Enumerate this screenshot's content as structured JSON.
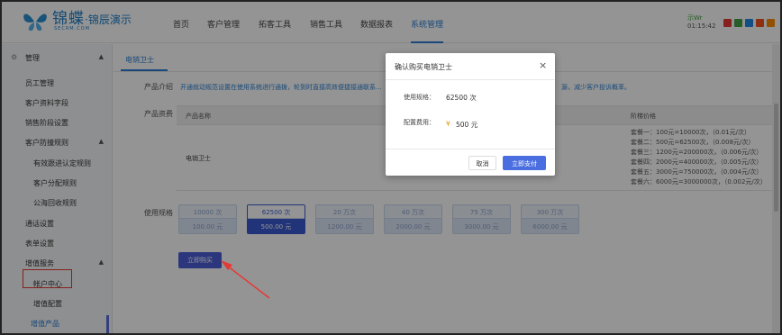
{
  "header": {
    "logo_cn": "锦蝶",
    "logo_sub": "·锦辰演示",
    "logo_en": "SECRM.COM",
    "nav": [
      "首页",
      "客户管理",
      "拓客工具",
      "销售工具",
      "数据报表",
      "系统管理"
    ],
    "active_nav": "系统管理",
    "date": "示Wr",
    "time": "01:15:42",
    "icon_colors": [
      "#e53935",
      "#43a047",
      "#1e88e5",
      "#f4511e",
      "#fb8c00"
    ]
  },
  "sidebar": {
    "items": [
      {
        "label": "管理",
        "chev": "▲"
      },
      {
        "label": "员工管理"
      },
      {
        "label": "客户资料字段"
      },
      {
        "label": "销售阶段设置"
      },
      {
        "label": "客户防撞规则",
        "chev": "▲"
      },
      {
        "label": "有效跟进认定规则"
      },
      {
        "label": "客户分配规则"
      },
      {
        "label": "公海回收规则"
      },
      {
        "label": "通话设置"
      },
      {
        "label": "表单设置"
      },
      {
        "label": "增值服务",
        "chev": "▲"
      },
      {
        "label": "帐户中心"
      },
      {
        "label": "增值配置"
      },
      {
        "label": "增值产品"
      }
    ]
  },
  "main": {
    "tab": "电销卫士",
    "intro_label": "产品介绍",
    "intro_text": "开通就动规范设置在使用系统进行通拨，轮到时直接高效便捷接通联系...",
    "intro_text2": "源，减少客户投诉概率。",
    "pricing_label": "产品资费",
    "col_name": "产品名称",
    "col_tier": "阶梯价格",
    "product_name": "电销卫士",
    "tiers": [
      "套餐一：100元=10000次，（0.01元/次）",
      "套餐二：500元=62500次，（0.008元/次）",
      "套餐三：1200元=200000次，（0.006元/次）",
      "套餐四：2000元=400000次，（0.005元/次）",
      "套餐五：3000元=750000次，（0.004元/次）",
      "套餐六：6000元=3000000次，（0.002元/次）"
    ],
    "spec_label": "使用规格",
    "specs": [
      {
        "count": "10000 次",
        "price": "100.00 元"
      },
      {
        "count": "62500 次",
        "price": "500.00 元"
      },
      {
        "count": "20 万次",
        "price": "1200.00 元"
      },
      {
        "count": "40 万次",
        "price": "2000.00 元"
      },
      {
        "count": "75 万次",
        "price": "3000.00 元"
      },
      {
        "count": "300 万次",
        "price": "6000.00 元"
      }
    ],
    "active_spec_index": 1,
    "buy_label": "立即购买"
  },
  "dialog": {
    "title": "确认购买电销卫士",
    "close": "×",
    "spec_label": "使用规格：",
    "spec_value": "62500 次",
    "price_label": "配置费用：",
    "currency": "¥",
    "price_value": "500 元",
    "cancel_label": "取消",
    "pay_label": "立即支付"
  }
}
